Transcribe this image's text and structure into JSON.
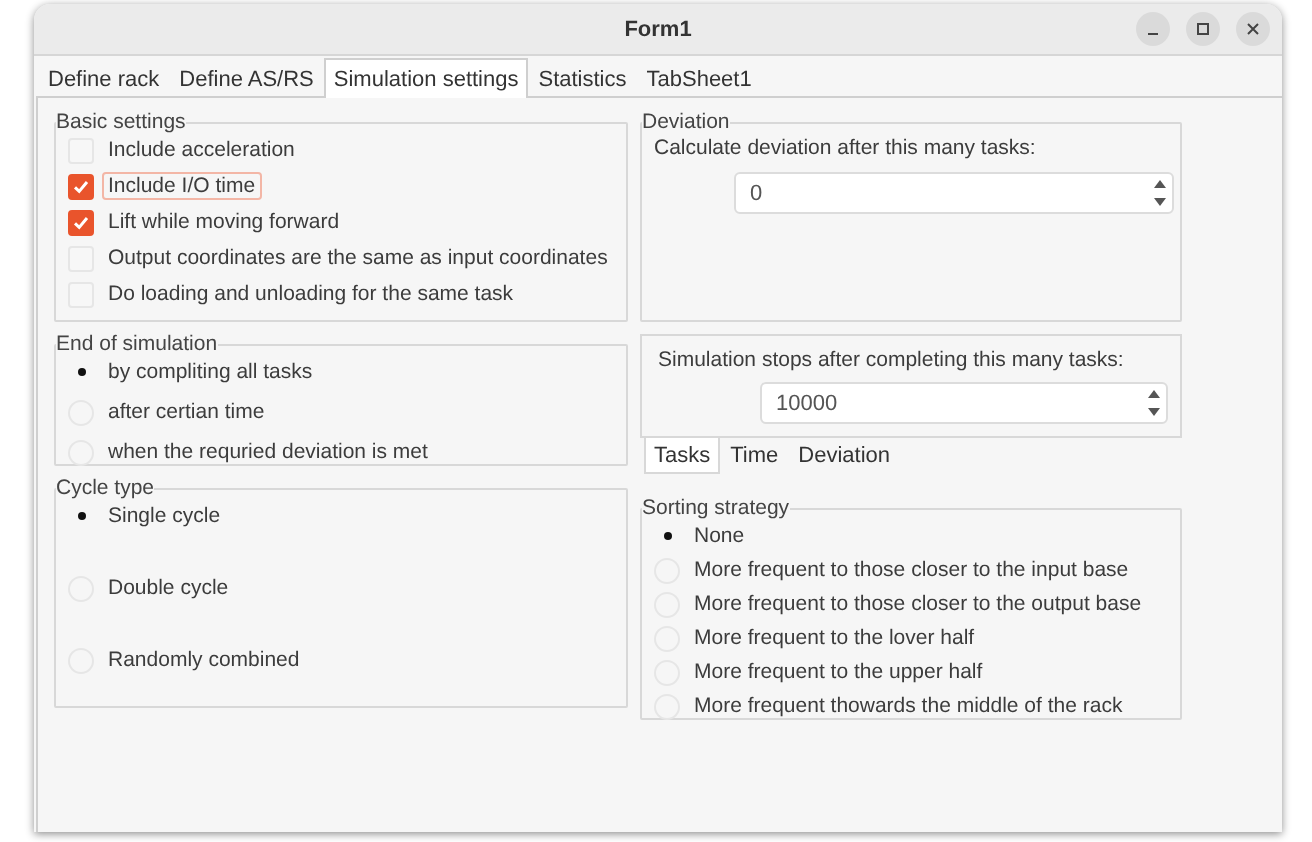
{
  "window": {
    "title": "Form1"
  },
  "tabs": [
    {
      "label": "Define rack",
      "selected": false
    },
    {
      "label": "Define AS/RS",
      "selected": false
    },
    {
      "label": "Simulation settings",
      "selected": true
    },
    {
      "label": "Statistics",
      "selected": false
    },
    {
      "label": "TabSheet1",
      "selected": false
    }
  ],
  "basic_settings": {
    "title": "Basic settings",
    "options": [
      {
        "label": "Include acceleration",
        "checked": false,
        "focused": false
      },
      {
        "label": "Include I/O time",
        "checked": true,
        "focused": true
      },
      {
        "label": "Lift while moving forward",
        "checked": true,
        "focused": false
      },
      {
        "label": "Output coordinates are the same as input coordinates",
        "checked": false,
        "focused": false
      },
      {
        "label": "Do loading and unloading for the same task",
        "checked": false,
        "focused": false
      }
    ]
  },
  "end_of_simulation": {
    "title": "End of simulation",
    "options": [
      {
        "label": "by compliting all tasks",
        "selected": true
      },
      {
        "label": "after certian time",
        "selected": false
      },
      {
        "label": "when the requried deviation is met",
        "selected": false
      }
    ]
  },
  "cycle_type": {
    "title": "Cycle type",
    "options": [
      {
        "label": "Single cycle",
        "selected": true
      },
      {
        "label": "Double cycle",
        "selected": false
      },
      {
        "label": "Randomly combined",
        "selected": false
      }
    ]
  },
  "deviation": {
    "title": "Deviation",
    "label": "Calculate deviation after this many tasks:",
    "value": "0"
  },
  "simulation_stop": {
    "label": "Simulation stops after completing this many tasks:",
    "value": "10000",
    "tabs": [
      {
        "label": "Tasks",
        "selected": true
      },
      {
        "label": "Time",
        "selected": false
      },
      {
        "label": "Deviation",
        "selected": false
      }
    ]
  },
  "sorting_strategy": {
    "title": "Sorting strategy",
    "options": [
      {
        "label": "None",
        "selected": true
      },
      {
        "label": "More frequent to those closer to the input base",
        "selected": false
      },
      {
        "label": "More frequent to those closer to the output base",
        "selected": false
      },
      {
        "label": "More frequent to the lover half",
        "selected": false
      },
      {
        "label": "More frequent to the upper half",
        "selected": false
      },
      {
        "label": "More frequent thowards the middle of the rack",
        "selected": false
      }
    ]
  }
}
